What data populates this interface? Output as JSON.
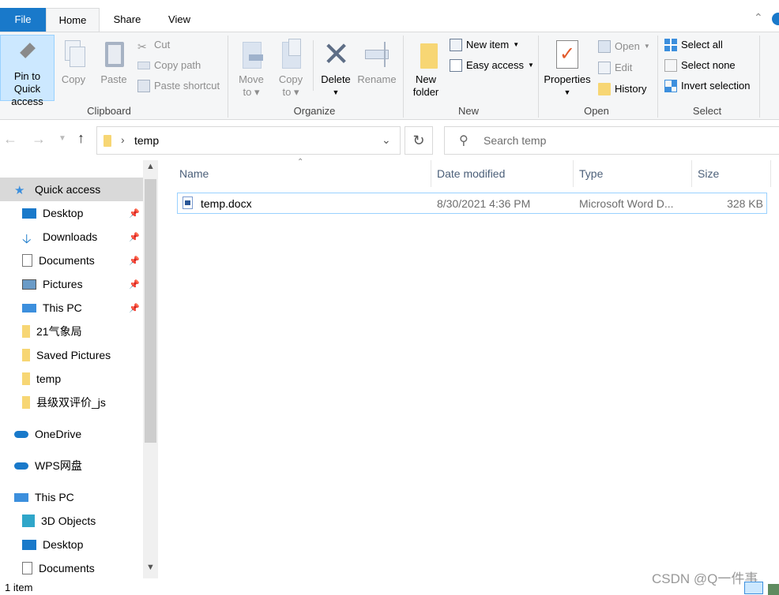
{
  "tabs": {
    "file": "File",
    "home": "Home",
    "share": "Share",
    "view": "View"
  },
  "ribbon": {
    "clipboard": {
      "label": "Clipboard",
      "pin": "Pin to Quick access",
      "pin_l1": "Pin to Quick",
      "pin_l2": "access",
      "copy": "Copy",
      "paste": "Paste",
      "cut": "Cut",
      "copy_path": "Copy path",
      "paste_shortcut": "Paste shortcut"
    },
    "organize": {
      "label": "Organize",
      "move_l1": "Move",
      "move_l2": "to",
      "copy_l1": "Copy",
      "copy_l2": "to",
      "delete": "Delete",
      "rename": "Rename"
    },
    "new": {
      "label": "New",
      "folder_l1": "New",
      "folder_l2": "folder",
      "new_item": "New item",
      "easy_access": "Easy access"
    },
    "open": {
      "label": "Open",
      "properties": "Properties",
      "open": "Open",
      "edit": "Edit",
      "history": "History"
    },
    "select": {
      "label": "Select",
      "all": "Select all",
      "none": "Select none",
      "invert": "Invert selection"
    }
  },
  "address": {
    "path": "temp",
    "search_placeholder": "Search temp"
  },
  "nav": {
    "items": [
      {
        "label": "Quick access",
        "icon": "star-icon",
        "selected": true
      },
      {
        "label": "Desktop",
        "icon": "desktop-icon",
        "pinned": true
      },
      {
        "label": "Downloads",
        "icon": "download-icon",
        "pinned": true
      },
      {
        "label": "Documents",
        "icon": "documents-icon",
        "pinned": true
      },
      {
        "label": "Pictures",
        "icon": "pictures-icon",
        "pinned": true
      },
      {
        "label": "This PC",
        "icon": "computer-icon",
        "pinned": true
      },
      {
        "label": "21气象局",
        "icon": "folder-icon"
      },
      {
        "label": "Saved Pictures",
        "icon": "folder-icon"
      },
      {
        "label": "temp",
        "icon": "folder-icon"
      },
      {
        "label": "县级双评价_js",
        "icon": "folder-icon"
      },
      {
        "label": "OneDrive",
        "icon": "cloud-icon"
      },
      {
        "label": "WPS网盘",
        "icon": "cloud-icon"
      },
      {
        "label": "This PC",
        "icon": "computer-icon"
      },
      {
        "label": "3D Objects",
        "icon": "cube-icon"
      },
      {
        "label": "Desktop",
        "icon": "desktop-icon"
      },
      {
        "label": "Documents",
        "icon": "documents-icon"
      }
    ]
  },
  "columns": {
    "name": "Name",
    "date": "Date modified",
    "type": "Type",
    "size": "Size"
  },
  "files": [
    {
      "name": "temp.docx",
      "date": "8/30/2021 4:36 PM",
      "type": "Microsoft Word D...",
      "size": "328 KB"
    }
  ],
  "status": {
    "count": "1 item"
  },
  "watermark": "CSDN @Q一件事",
  "colors": {
    "accent": "#1979ca",
    "selection": "#cce8ff",
    "folder": "#f7d674"
  }
}
